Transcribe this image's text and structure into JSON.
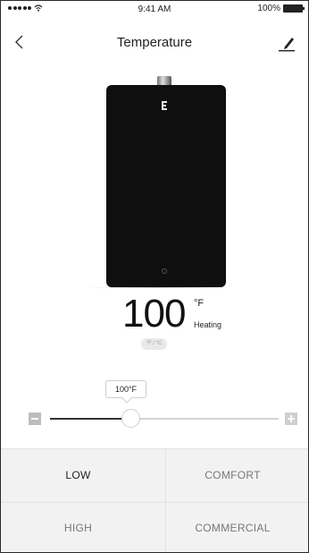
{
  "status_bar": {
    "time": "9:41 AM",
    "battery": "100%",
    "icons": [
      "signal-dots-icon",
      "wifi-icon",
      "battery-icon"
    ]
  },
  "nav": {
    "title": "Temperature",
    "back_icon": "chevron-left-icon",
    "edit_icon": "pencil-icon"
  },
  "heater": {
    "logo_letter": "E",
    "body_color": "#0f0f0f"
  },
  "temperature": {
    "value": "100",
    "unit": "°F",
    "status": "Heating",
    "unit_toggle": "°F / °C"
  },
  "slider": {
    "tooltip": "100°F",
    "level": 0.35,
    "minus_icon": "minus-icon",
    "plus_icon": "plus-icon"
  },
  "modes": [
    {
      "label": "LOW",
      "active": true
    },
    {
      "label": "COMFORT",
      "active": false
    },
    {
      "label": "HIGH",
      "active": false
    },
    {
      "label": "COMMERCIAL",
      "active": false
    }
  ],
  "colors": {
    "accent": "#333333",
    "mode_background": "#f2f2f2"
  }
}
